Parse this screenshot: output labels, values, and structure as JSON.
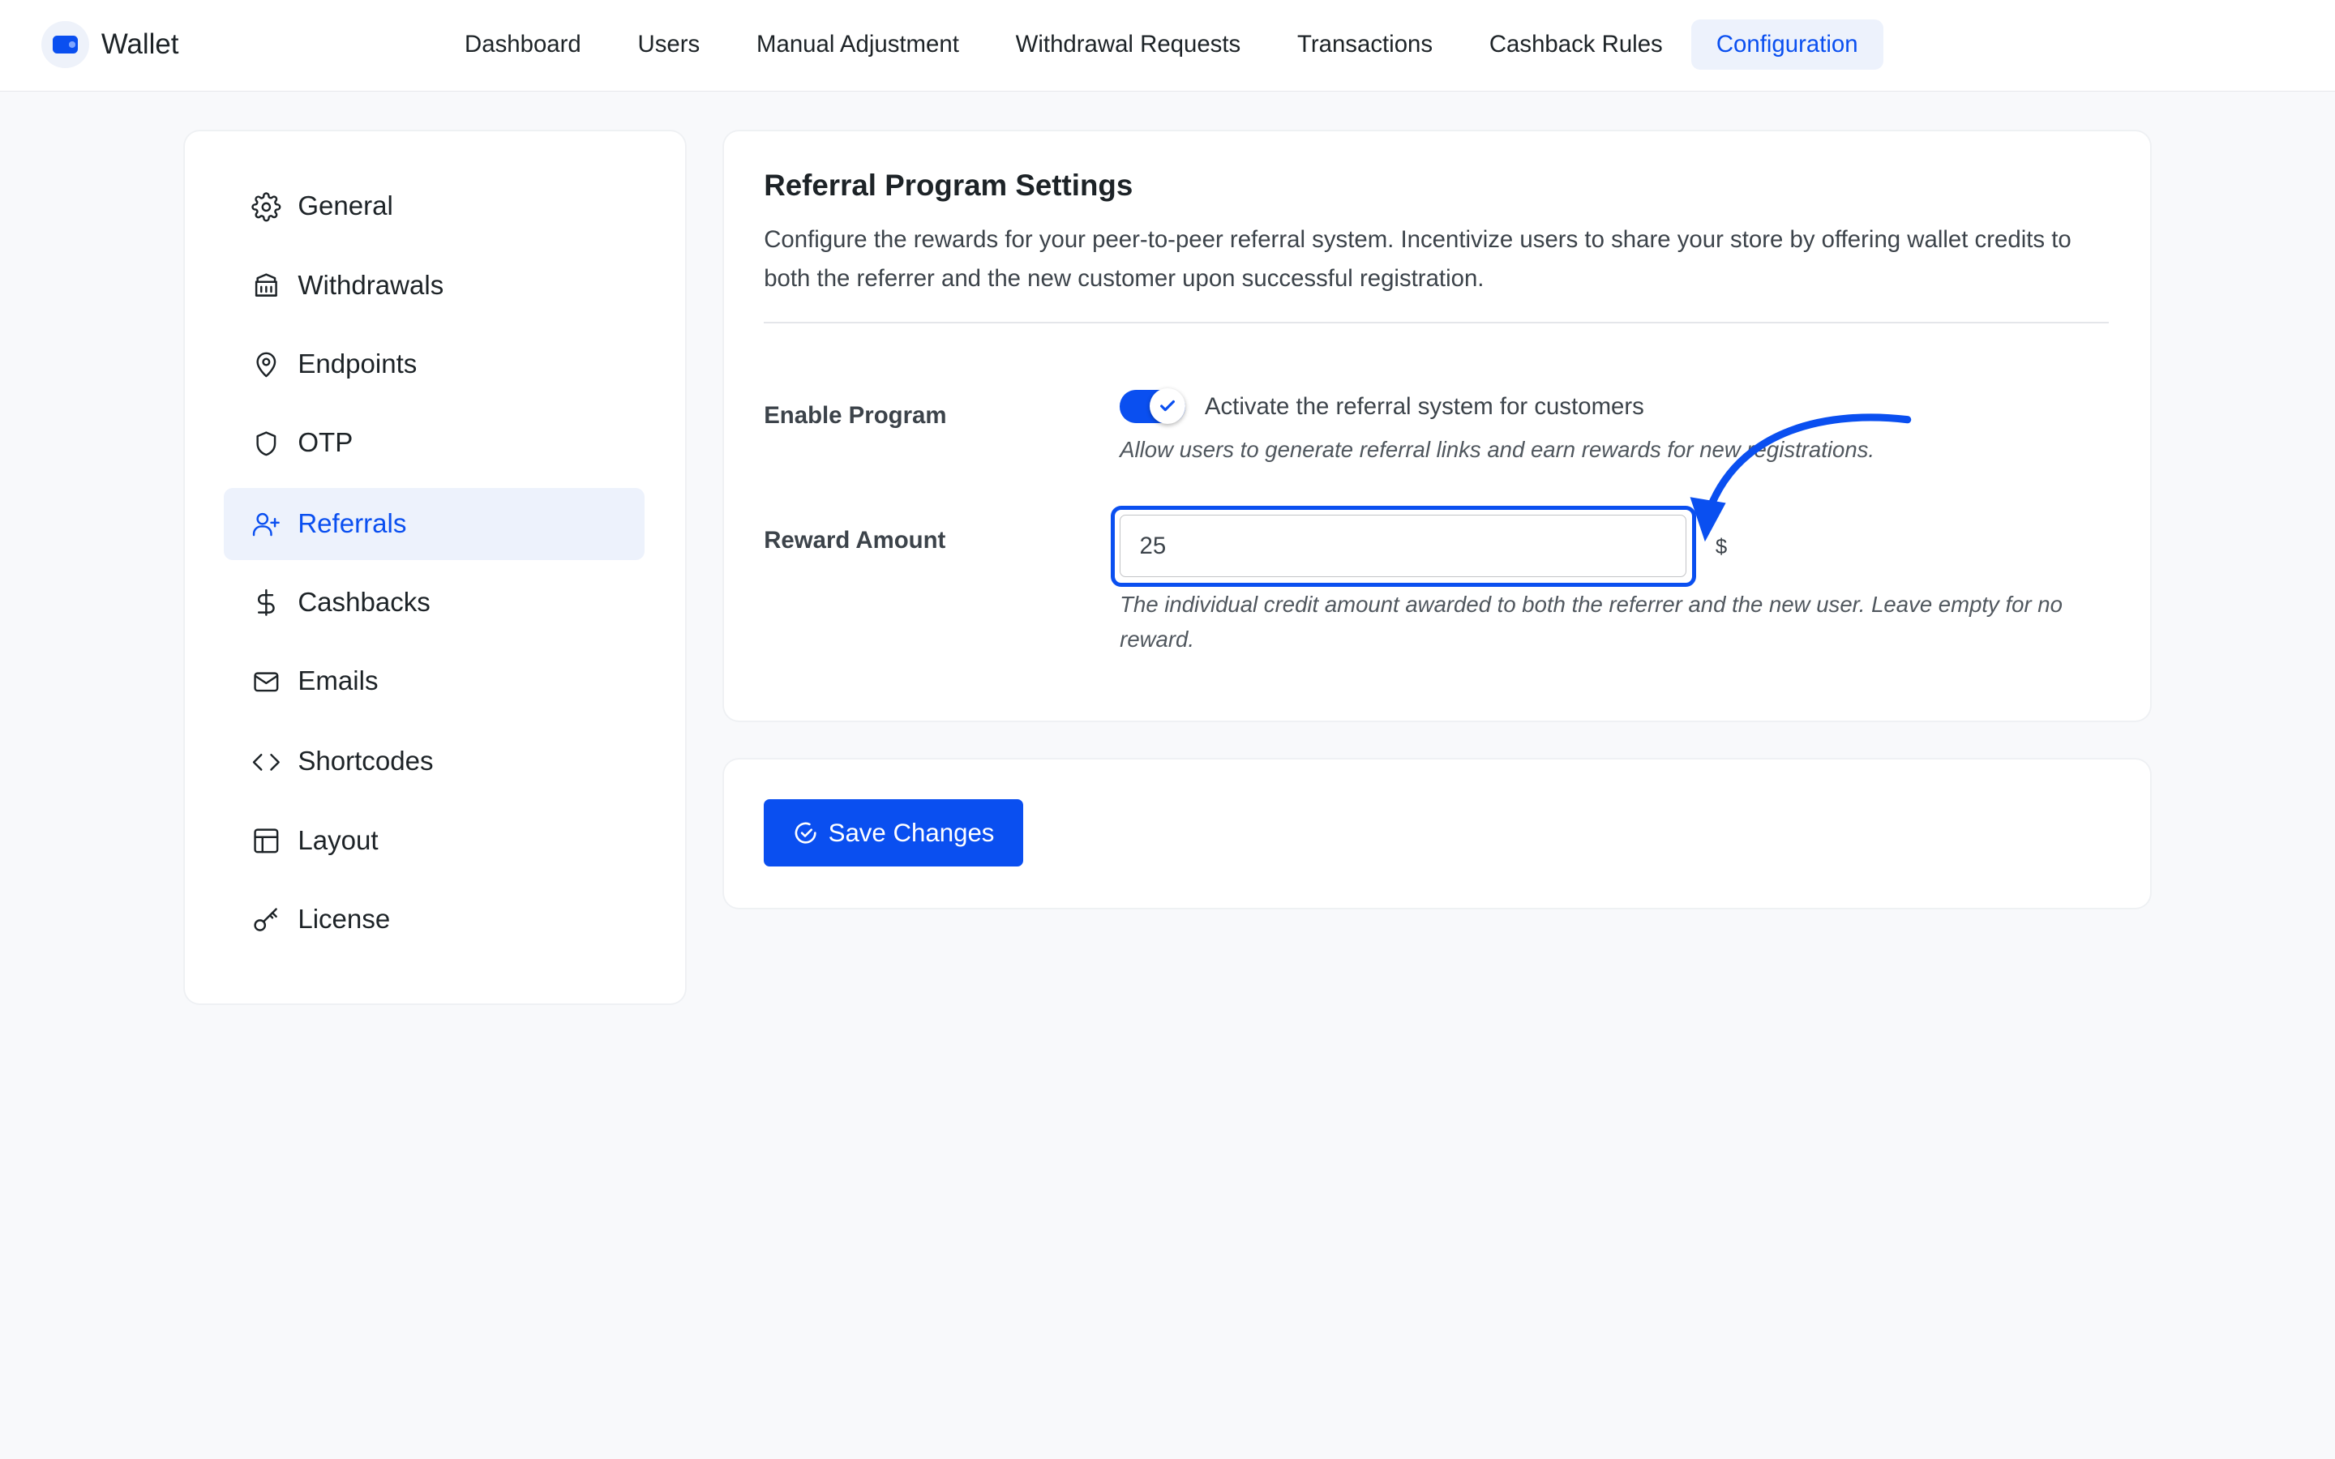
{
  "brand": {
    "name": "Wallet",
    "icon": "wallet-icon",
    "accent": "#0a4ff0"
  },
  "nav": {
    "items": [
      {
        "label": "Dashboard"
      },
      {
        "label": "Users"
      },
      {
        "label": "Manual Adjustment"
      },
      {
        "label": "Withdrawal Requests"
      },
      {
        "label": "Transactions"
      },
      {
        "label": "Cashback Rules"
      },
      {
        "label": "Configuration",
        "active": true
      }
    ]
  },
  "sidebar": {
    "items": [
      {
        "label": "General",
        "icon": "gear-icon"
      },
      {
        "label": "Withdrawals",
        "icon": "bank-icon"
      },
      {
        "label": "Endpoints",
        "icon": "map-pin-icon"
      },
      {
        "label": "OTP",
        "icon": "shield-icon"
      },
      {
        "label": "Referrals",
        "icon": "user-plus-icon",
        "active": true
      },
      {
        "label": "Cashbacks",
        "icon": "dollar-icon"
      },
      {
        "label": "Emails",
        "icon": "mail-icon"
      },
      {
        "label": "Shortcodes",
        "icon": "code-icon"
      },
      {
        "label": "Layout",
        "icon": "layout-icon"
      },
      {
        "label": "License",
        "icon": "key-icon"
      }
    ]
  },
  "settings": {
    "title": "Referral Program Settings",
    "description": "Configure the rewards for your peer-to-peer referral system. Incentivize users to share your store by offering wallet credits to both the referrer and the new customer upon successful registration.",
    "enable": {
      "label": "Enable Program",
      "checked": true,
      "toggle_text": "Activate the referral system for customers",
      "help": "Allow users to generate referral links and earn rewards for new registrations."
    },
    "reward": {
      "label": "Reward Amount",
      "value": "25",
      "currency": "$",
      "help": "The individual credit amount awarded to both the referrer and the new user. Leave empty for no reward."
    }
  },
  "actions": {
    "save_label": "Save Changes"
  }
}
